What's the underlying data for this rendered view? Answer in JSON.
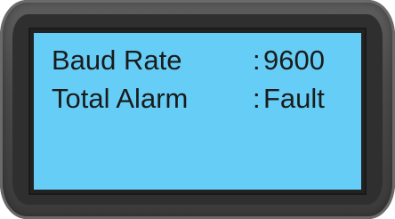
{
  "display": {
    "rows": [
      {
        "label": "Baud Rate",
        "separator": ":",
        "value": "9600"
      },
      {
        "label": "Total Alarm",
        "separator": ":",
        "value": "Fault"
      }
    ]
  },
  "colors": {
    "screen_background": "#65cdf6",
    "screen_text": "#1b1b1b",
    "bezel": "#4a4a4a",
    "screen_border": "#222222"
  }
}
